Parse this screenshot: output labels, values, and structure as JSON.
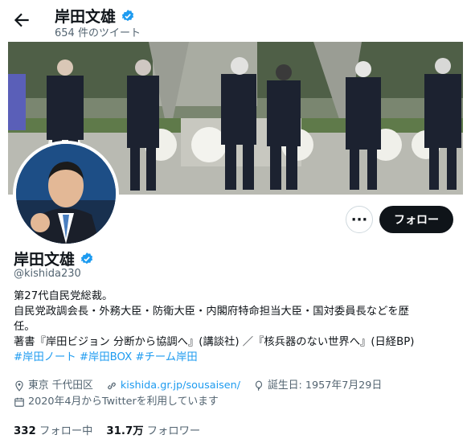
{
  "header": {
    "name": "岸田文雄",
    "tweet_count": "654 件のツイート"
  },
  "actions": {
    "more_label": "···",
    "follow_label": "フォロー"
  },
  "profile": {
    "name": "岸田文雄",
    "handle": "@kishida230"
  },
  "bio": {
    "line1": "第27代自民党総裁。",
    "line2": "自民党政調会長・外務大臣・防衛大臣・内閣府特命担当大臣・国対委員長などを歴",
    "line3": "任。",
    "line4": "著書『岸田ビジョン 分断から協調へ』(講談社) ／『核兵器のない世界へ』(日経BP)",
    "tags": [
      "#岸田ノート",
      "#岸田BOX",
      "#チーム岸田"
    ]
  },
  "meta": {
    "location": "東京 千代田区",
    "website": "kishida.gr.jp/sousaisen/",
    "birthday": "誕生日: 1957年7月29日",
    "joined": "2020年4月からTwitterを利用しています"
  },
  "stats": {
    "following_count": "332",
    "following_label": "フォロー中",
    "followers_count": "31.7万",
    "followers_label": "フォロワー"
  },
  "colors": {
    "accent": "#1d9bf0",
    "text": "#0f1419",
    "muted": "#536471",
    "follow_button": "#0f1419"
  }
}
